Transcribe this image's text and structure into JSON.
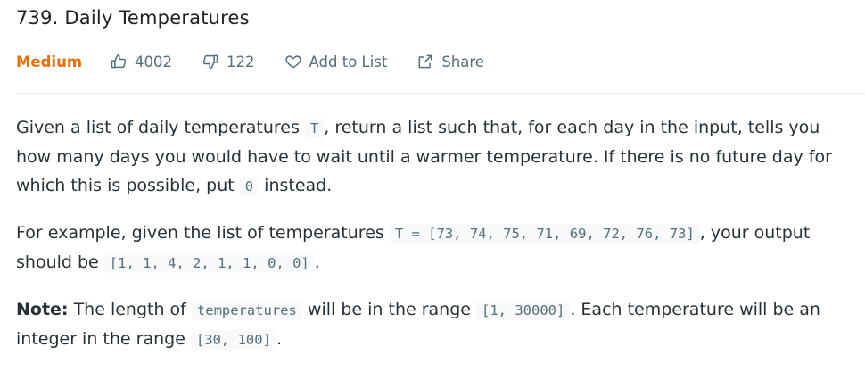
{
  "problem": {
    "title": "739. Daily Temperatures",
    "difficulty": "Medium",
    "likes": "4002",
    "dislikes": "122",
    "add_to_list_label": "Add to List",
    "share_label": "Share"
  },
  "description": {
    "p1_part1": "Given a list of daily temperatures ",
    "p1_code1": "T",
    "p1_part2": ", return a list such that, for each day in the input, tells you how many days you would have to wait until a warmer temperature. If there is no future day for which this is possible, put ",
    "p1_code2": "0",
    "p1_part3": " instead.",
    "p2_part1": "For example, given the list of temperatures ",
    "p2_code1": "T = [73, 74, 75, 71, 69, 72, 76, 73]",
    "p2_part2": ", your output should be ",
    "p2_code2": "[1, 1, 4, 2, 1, 1, 0, 0]",
    "p2_part3": ".",
    "note_label": "Note:",
    "p3_part1": " The length of ",
    "p3_code1": "temperatures",
    "p3_part2": " will be in the range ",
    "p3_code2": "[1, 30000]",
    "p3_part3": ". Each temperature will be an integer in the range ",
    "p3_code3": "[30, 100]",
    "p3_part4": "."
  }
}
